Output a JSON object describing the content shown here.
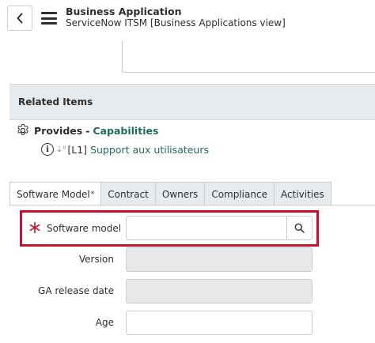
{
  "header": {
    "title": "Business Application",
    "subtitle": "ServiceNow ITSM [Business Applications view]",
    "back_icon": "chevron-left-icon",
    "menu_icon": "hamburger-icon"
  },
  "related": {
    "section_label": "Related Items",
    "provides_label": "Provides",
    "separator": "-",
    "capabilities_label": "Capabilities",
    "child_prefix": "[L1]",
    "child_label": "Support aux utilisateurs"
  },
  "tabs": [
    {
      "label": "Software Model",
      "active": true,
      "mark": "*"
    },
    {
      "label": "Contract",
      "active": false
    },
    {
      "label": "Owners",
      "active": false
    },
    {
      "label": "Compliance",
      "active": false
    },
    {
      "label": "Activities",
      "active": false
    }
  ],
  "form": {
    "software_model_label": "Software model",
    "software_model_value": "",
    "version_label": "Version",
    "version_value": "",
    "ga_release_label": "GA release date",
    "ga_release_value": "",
    "age_label": "Age",
    "age_value": ""
  },
  "colors": {
    "link": "#1f6b5c",
    "highlight": "#c8102e",
    "required": "#c8102e",
    "section_bg": "#e8ebee"
  }
}
